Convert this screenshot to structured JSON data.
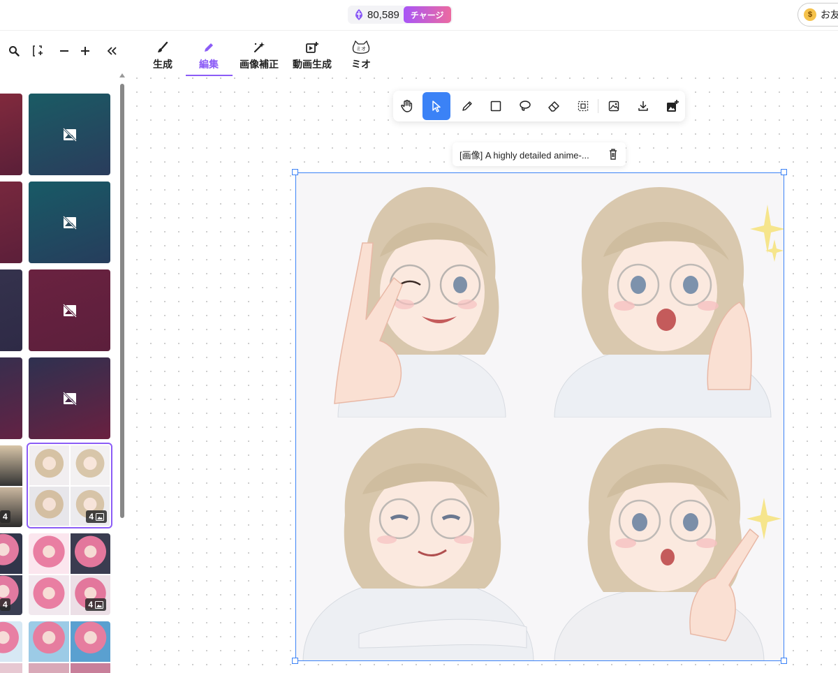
{
  "topbar": {
    "credits": "80,589",
    "charge_label": "チャージ",
    "friend_label": "お友"
  },
  "left_tools": [
    {
      "name": "search-icon",
      "glyph": "🔍"
    },
    {
      "name": "select-area-icon",
      "glyph": "⬚"
    },
    {
      "name": "zoom-out-icon",
      "glyph": "−"
    },
    {
      "name": "zoom-in-icon",
      "glyph": "+"
    },
    {
      "name": "collapse-icon",
      "glyph": "«"
    }
  ],
  "tabs": [
    {
      "label": "生成",
      "icon": "brush-icon"
    },
    {
      "label": "編集",
      "icon": "pencil-icon",
      "active": true
    },
    {
      "label": "画像補正",
      "icon": "magic-wand-icon"
    },
    {
      "label": "動画生成",
      "icon": "video-plus-icon"
    },
    {
      "label": "ミオ",
      "icon": "mio-cat-icon",
      "icon_text": "ミオ"
    }
  ],
  "toolbar": {
    "tools": [
      "hand-tool",
      "pointer-tool",
      "pencil-tool",
      "rectangle-tool",
      "lasso-tool",
      "eraser-tool",
      "selection-tool",
      "image-adjust-tool",
      "download-tool",
      "add-image-tool"
    ],
    "active": "pointer-tool"
  },
  "caption": {
    "text": "[画像] A highly detailed anime-..."
  },
  "sidebar": {
    "badge_count": "4"
  },
  "colors": {
    "accent": "#8b5cf6",
    "select_blue": "#3b82f6",
    "placeholder_teal": "#1f5060",
    "placeholder_crimson": "#6e2040"
  }
}
